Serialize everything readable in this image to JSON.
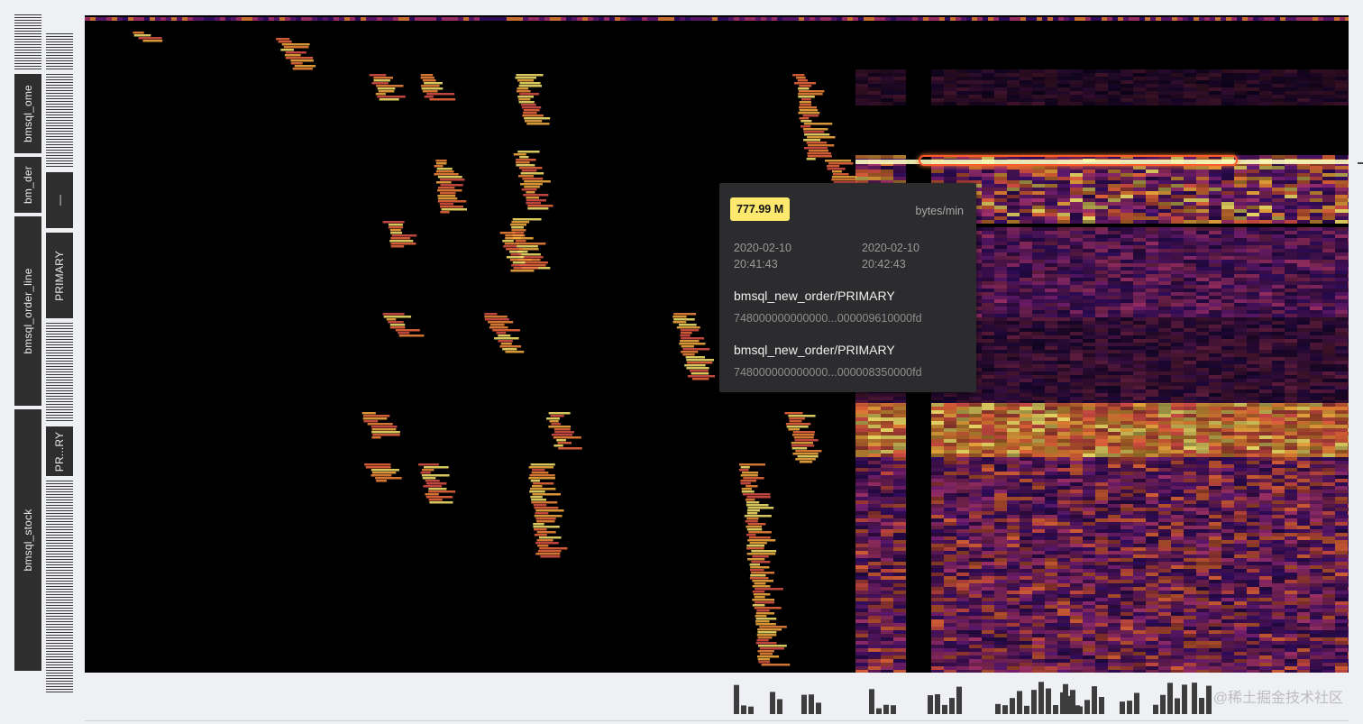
{
  "sidebar": {
    "tables": [
      {
        "label": "",
        "type": "stripe",
        "h": 62
      },
      {
        "label": "bmsql_ome",
        "type": "label",
        "h": 88
      },
      {
        "label": "bm_der",
        "type": "label",
        "h": 62
      },
      {
        "label": "bmsql_order_line",
        "type": "label",
        "h": 210
      },
      {
        "label": "bmsql_stock",
        "type": "label",
        "h": 290
      }
    ],
    "indexes": [
      {
        "label": "",
        "type": "stripe",
        "h": 40
      },
      {
        "label": "",
        "type": "stripe",
        "h": 104
      },
      {
        "label": "—",
        "type": "label",
        "h": 62
      },
      {
        "label": "PRIMARY",
        "type": "label",
        "h": 95
      },
      {
        "label": "",
        "type": "stripe",
        "h": 110
      },
      {
        "label": "PR...RY",
        "type": "label",
        "h": 55
      },
      {
        "label": "",
        "type": "stripe",
        "h": 236
      }
    ]
  },
  "tooltip": {
    "value": "777.99 M",
    "unit": "bytes/min",
    "start_date": "2020-02-10",
    "start_time": "20:41:43",
    "end_date": "2020-02-10",
    "end_time": "20:42:43",
    "start_key_name": "bmsql_new_order/PRIMARY",
    "start_key_id": "748000000000000...000009610000fd",
    "end_key_name": "bmsql_new_order/PRIMARY",
    "end_key_id": "748000000000000...000008350000fd"
  },
  "watermark": "@稀土掘金技术社区",
  "colors": {
    "background": "#000000",
    "low": "#3b0f6f",
    "mid": "#b73779",
    "high": "#fd9a44",
    "peak": "#fcfdbf",
    "selection": "#ff5a2c"
  }
}
